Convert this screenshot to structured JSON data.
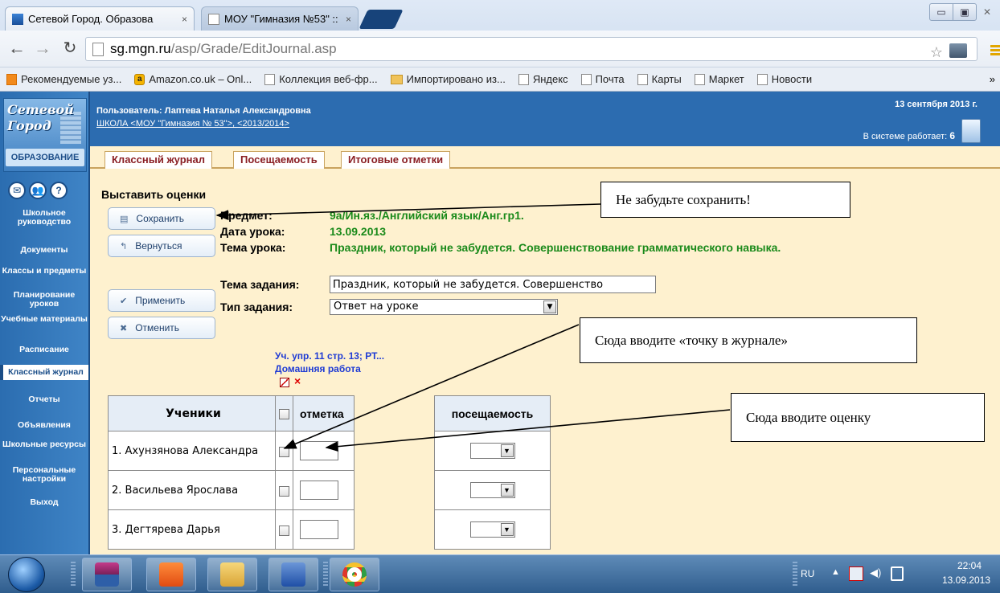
{
  "browser": {
    "tabs": [
      {
        "title": "Сетевой Город. Образова",
        "close": "×"
      },
      {
        "title": "МОУ \"Гимназия №53\" ::",
        "close": "×"
      }
    ],
    "url_host": "sg.mgn.ru",
    "url_path": "/asp/Grade/EditJournal.asp",
    "bookmarks": [
      "Рекомендуемые уз...",
      "Amazon.co.uk – Onl...",
      "Коллекция веб-фр...",
      "Импортировано из...",
      "Яндекс",
      "Почта",
      "Карты",
      "Маркет",
      "Новости"
    ],
    "bookmarks_more": "»"
  },
  "sidebar": {
    "logo": {
      "line1": "Сетевой",
      "line2": "Город",
      "line3": "ОБРАЗОВАНИЕ"
    },
    "round_icons": [
      "✉",
      "👥",
      "?"
    ],
    "items": [
      {
        "label": "Школьное руководство"
      },
      {
        "label": "Документы"
      },
      {
        "label": "Классы и предметы"
      },
      {
        "label": "Планирование уроков"
      },
      {
        "label": "Учебные материалы"
      },
      {
        "label": "Расписание"
      },
      {
        "label": "Классный журнал"
      },
      {
        "label": "Отчеты"
      },
      {
        "label": "Объявления"
      },
      {
        "label": "Школьные ресурсы"
      },
      {
        "label": "Персональные настройки"
      },
      {
        "label": "Выход"
      }
    ]
  },
  "header": {
    "user": "Пользователь: Лаптева Наталья Александровна",
    "school": "ШКОЛА <МОУ \"Гимназия № 53\">",
    "year": ",  <2013/2014>",
    "date": "13 сентября 2013 г.",
    "online_label": "В системе работает:",
    "online_count": "6"
  },
  "page_tabs": [
    "Классный журнал",
    "Посещаемость",
    "Итоговые отметки"
  ],
  "form": {
    "title": "Выставить оценки",
    "buttons": {
      "save": "Сохранить",
      "back": "Вернуться",
      "apply": "Применить",
      "cancel": "Отменить"
    },
    "subject_label": "Предмет:",
    "subject_value": "9а/Ин.яз./Английский язык/Анг.гр1.",
    "date_label": "Дата урока:",
    "date_value": "13.09.2013",
    "topic_label": "Тема урока:",
    "topic_value": "Праздник, который не забудется. Совершенствование грамматического навыка.",
    "task_topic_label": "Тема задания:",
    "task_topic_value": "Праздник, который не забудется. Совершенство",
    "task_type_label": "Тип задания:",
    "task_type_value": "Ответ на уроке"
  },
  "homework": {
    "title": "Уч. упр. 11 стр. 13; РТ...",
    "subtitle": "Домашняя работа"
  },
  "table": {
    "col_students": "Ученики",
    "col_mark": "отметка",
    "col_attendance": "посещаемость",
    "students": [
      "1. Ахунзянова Александра",
      "2. Васильева Ярослава",
      "3. Дегтярева Дарья"
    ]
  },
  "callouts": {
    "save": "Не забудьте сохранить!",
    "dot": "Сюда вводите «точку в журнале»",
    "grade": "Сюда вводите оценку"
  },
  "taskbar": {
    "lang": "RU",
    "time": "22:04",
    "date": "13.09.2013"
  },
  "colors": {
    "header_blue": "#2c6cb0",
    "tab_text": "#8a1f24",
    "value_green": "#1a8a1a",
    "homework_blue": "#1f3bd4",
    "content_bg": "#fef1cf"
  }
}
